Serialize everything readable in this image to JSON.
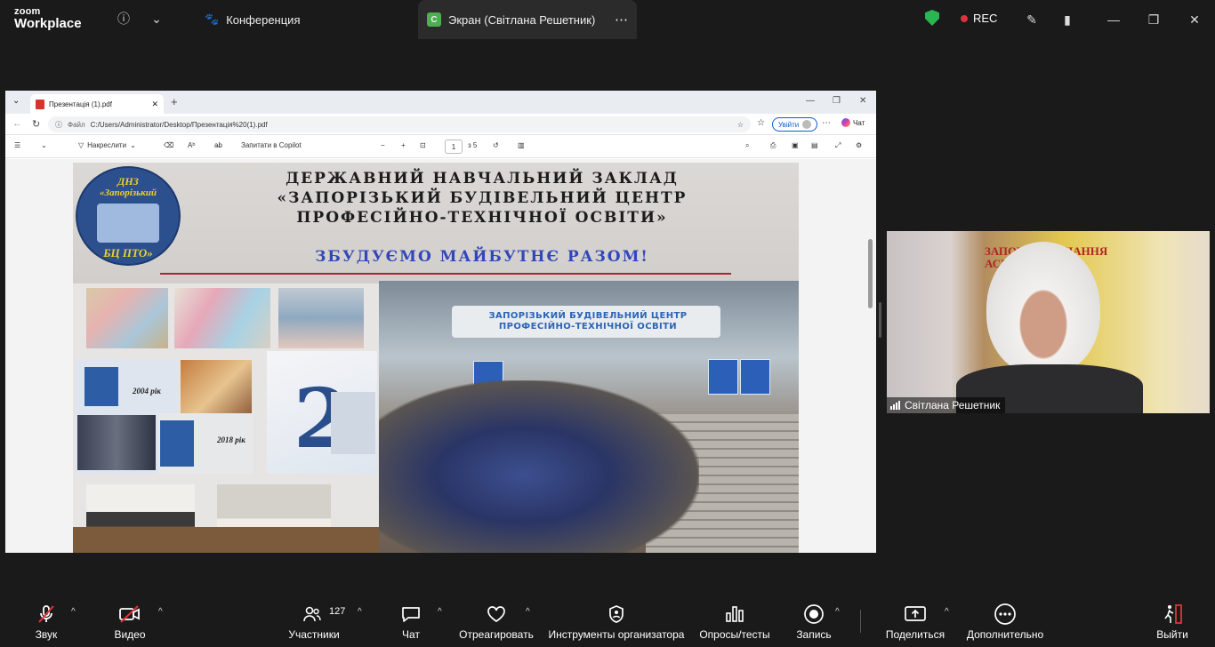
{
  "topbar": {
    "brand_top": "zoom",
    "brand_bottom": "Workplace",
    "tab_conference": "Конференция",
    "tab_screen_badge": "С",
    "tab_screen": "Экран (Світлана Решетник)",
    "rec_label": "REC"
  },
  "browser": {
    "tab_title": "Презентація (1).pdf",
    "address_label": "Файл",
    "address_url": "C:/Users/Administrator/Desktop/Презентація%20(1).pdf",
    "signin_label": "Увійти",
    "chat_label": "Чат",
    "draw_label": "Накреслити",
    "copilot_label": "Запитати в Copilot",
    "page_current": "1",
    "page_total": "з 5"
  },
  "slide": {
    "logo_line1": "ДНЗ",
    "logo_line2": "«Запорізький",
    "logo_line3": "БЦ ПТО»",
    "title_line1": "ДЕРЖАВНИЙ НАВЧАЛЬНИЙ ЗАКЛАД",
    "title_line2": "«ЗАПОРІЗЬКИЙ БУДІВЕЛЬНИЙ ЦЕНТР",
    "title_line3": "ПРОФЕСІЙНО-ТЕХНІЧНОЇ ОСВІТИ»",
    "motto": "ЗБУДУЄМО МАЙБУТНЄ РАЗОМ!",
    "year_2004": "2004 рік",
    "year_2018": "2018 рік",
    "building_sign_line1": "ЗАПОРІЗЬКИЙ БУДІВЕЛЬНИЙ ЦЕНТР",
    "building_sign_line2": "ПРОФЕСІЙНО-ТЕХНІЧНОЇ ОСВІТИ",
    "poster_number": "2"
  },
  "webcam": {
    "name": "Світлана Решетник",
    "poster_text": "ЗАПОРІ... НАВЧАННЯ АСІВ"
  },
  "bottombar": {
    "audio": "Звук",
    "video": "Видео",
    "participants": "Участники",
    "participants_count": "127",
    "chat": "Чат",
    "react": "Отреагировать",
    "host_tools": "Инструменты организатора",
    "polls": "Опросы/тесты",
    "record": "Запись",
    "share": "Поделиться",
    "more": "Дополнительно",
    "leave": "Выйти"
  },
  "colors": {
    "background": "#1a1a1a",
    "rec_dot": "#e0323a",
    "shield": "#2ab553",
    "motto": "#3147b8",
    "leave": "#e0323a"
  }
}
